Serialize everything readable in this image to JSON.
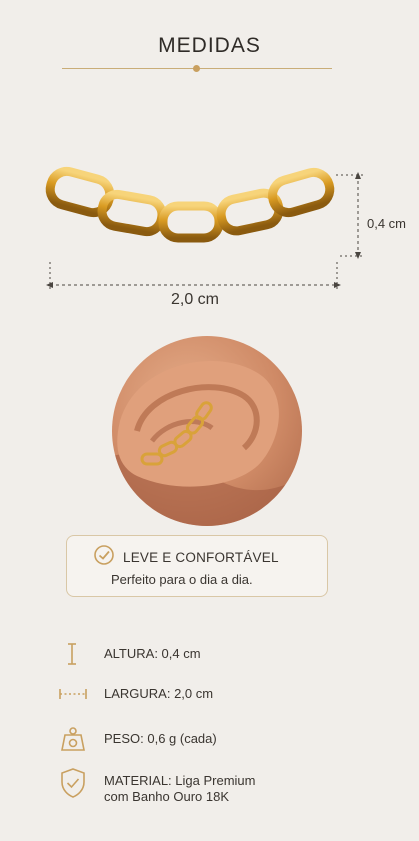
{
  "header": {
    "title": "MEDIDAS"
  },
  "dimensions": {
    "height": "0,4 cm",
    "width": "2,0 cm"
  },
  "feature": {
    "title": "LEVE E CONFORTÁVEL",
    "subtitle": "Perfeito para o dia a dia."
  },
  "specs": {
    "height": "ALTURA: 0,4 cm",
    "width": "LARGURA: 2,0 cm",
    "weight": "PESO: 0,6 g (cada)",
    "material_line1": "MATERIAL: Liga Premium",
    "material_line2": "com Banho Ouro 18K"
  },
  "colors": {
    "background": "#f1eeea",
    "accent_gold": "#c9a060",
    "text": "#3a3530"
  }
}
